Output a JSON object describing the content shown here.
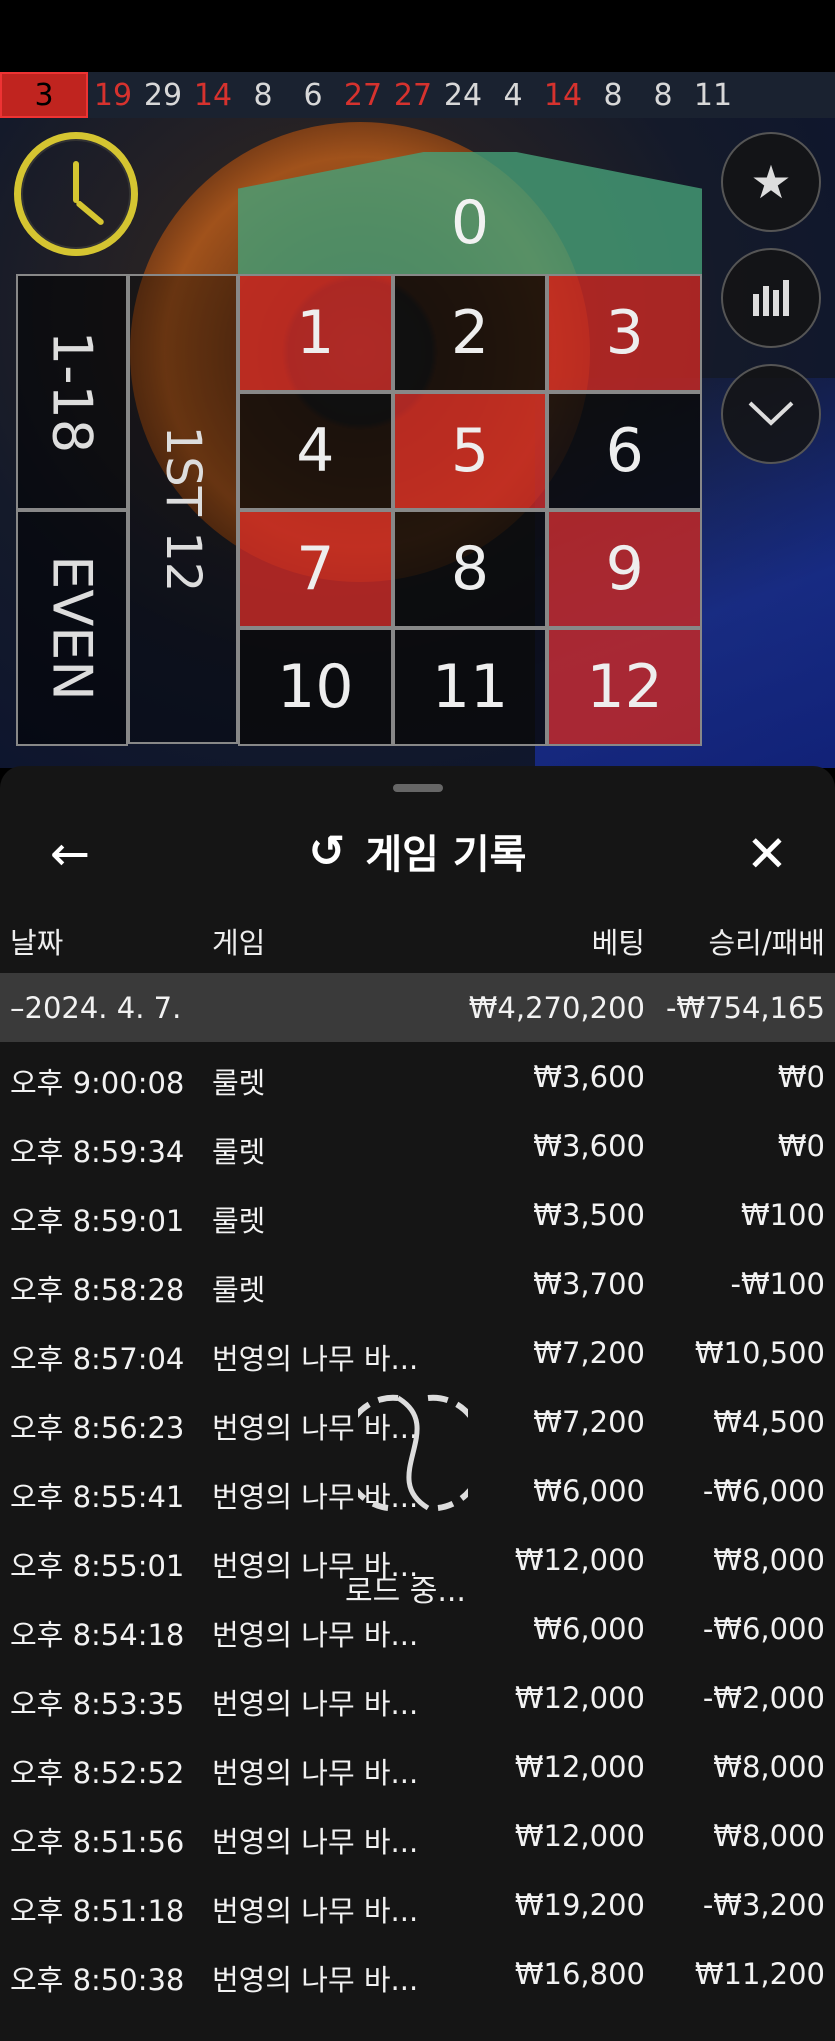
{
  "history_strip": [
    {
      "n": "3",
      "color": "first"
    },
    {
      "n": "19",
      "color": "r"
    },
    {
      "n": "29",
      "color": "b"
    },
    {
      "n": "14",
      "color": "r"
    },
    {
      "n": "8",
      "color": "b"
    },
    {
      "n": "6",
      "color": "b"
    },
    {
      "n": "27",
      "color": "r"
    },
    {
      "n": "27",
      "color": "r"
    },
    {
      "n": "24",
      "color": "b"
    },
    {
      "n": "4",
      "color": "b"
    },
    {
      "n": "14",
      "color": "r"
    },
    {
      "n": "8",
      "color": "b"
    },
    {
      "n": "8",
      "color": "b"
    },
    {
      "n": "11",
      "color": "b"
    }
  ],
  "table": {
    "zero": "0",
    "numbers": [
      {
        "n": "1",
        "c": "r"
      },
      {
        "n": "2",
        "c": "b"
      },
      {
        "n": "3",
        "c": "r"
      },
      {
        "n": "4",
        "c": "b"
      },
      {
        "n": "5",
        "c": "r"
      },
      {
        "n": "6",
        "c": "b"
      },
      {
        "n": "7",
        "c": "r"
      },
      {
        "n": "8",
        "c": "b"
      },
      {
        "n": "9",
        "c": "r"
      },
      {
        "n": "10",
        "c": "b"
      },
      {
        "n": "11",
        "c": "b"
      },
      {
        "n": "12",
        "c": "r"
      }
    ],
    "low_label": "1-18",
    "even_label": "EVEN",
    "dozen_label": "1ST 12"
  },
  "panel": {
    "back_icon": "←",
    "title": "게임 기록",
    "history_icon": "↺",
    "close_icon": "✕",
    "headers": {
      "date": "날짜",
      "game": "게임",
      "bet": "베팅",
      "result": "승리/패배"
    },
    "summary": {
      "date": "–2024. 4. 7.",
      "bet": "₩4,270,200",
      "result": "-₩754,165"
    },
    "rows": [
      {
        "time": "오후 9:00:08",
        "game": "룰렛",
        "bet": "₩3,600",
        "result": "₩0"
      },
      {
        "time": "오후 8:59:34",
        "game": "룰렛",
        "bet": "₩3,600",
        "result": "₩0"
      },
      {
        "time": "오후 8:59:01",
        "game": "룰렛",
        "bet": "₩3,500",
        "result": "₩100"
      },
      {
        "time": "오후 8:58:28",
        "game": "룰렛",
        "bet": "₩3,700",
        "result": "-₩100"
      },
      {
        "time": "오후 8:57:04",
        "game": "번영의 나무 바...",
        "bet": "₩7,200",
        "result": "₩10,500"
      },
      {
        "time": "오후 8:56:23",
        "game": "번영의 나무 바...",
        "bet": "₩7,200",
        "result": "₩4,500"
      },
      {
        "time": "오후 8:55:41",
        "game": "번영의 나무 바...",
        "bet": "₩6,000",
        "result": "-₩6,000"
      },
      {
        "time": "오후 8:55:01",
        "game": "번영의 나무 바...",
        "bet": "₩12,000",
        "result": "₩8,000"
      },
      {
        "time": "오후 8:54:18",
        "game": "번영의 나무 바...",
        "bet": "₩6,000",
        "result": "-₩6,000"
      },
      {
        "time": "오후 8:53:35",
        "game": "번영의 나무 바...",
        "bet": "₩12,000",
        "result": "-₩2,000"
      },
      {
        "time": "오후 8:52:52",
        "game": "번영의 나무 바...",
        "bet": "₩12,000",
        "result": "₩8,000"
      },
      {
        "time": "오후 8:51:56",
        "game": "번영의 나무 바...",
        "bet": "₩12,000",
        "result": "₩8,000"
      },
      {
        "time": "오후 8:51:18",
        "game": "번영의 나무 바...",
        "bet": "₩19,200",
        "result": "-₩3,200"
      },
      {
        "time": "오후 8:50:38",
        "game": "번영의 나무 바...",
        "bet": "₩16,800",
        "result": "₩11,200"
      }
    ],
    "loading_text": "로드 중..."
  },
  "icons": {
    "clock": "clock-icon",
    "star": "★",
    "stats": "▮▮▮",
    "chevron": "⌄"
  }
}
